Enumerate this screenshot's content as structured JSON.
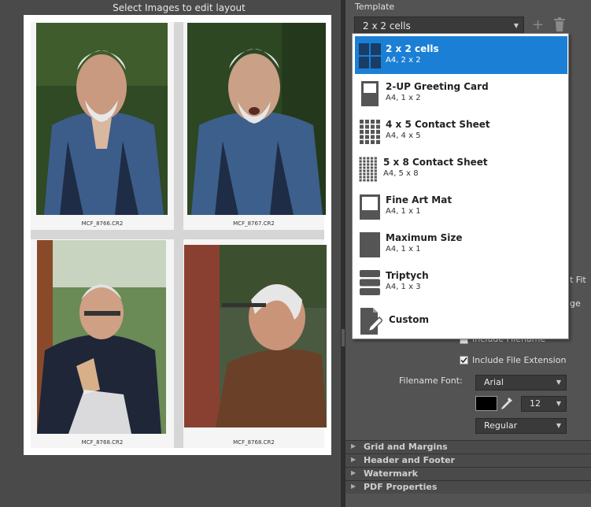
{
  "left_panel": {
    "title": "Select Images to edit layout",
    "photos": [
      {
        "filename": "MCF_8766.CR2"
      },
      {
        "filename": "MCF_8767.CR2"
      },
      {
        "filename": "MCF_8768.CR2"
      },
      {
        "filename": "MCF_8768.CR2"
      }
    ]
  },
  "right_panel": {
    "template_label": "Template",
    "template_value": "2 x 2 cells",
    "add_icon": "plus-icon",
    "delete_icon": "trash-icon",
    "dropdown": [
      {
        "name": "2 x 2 cells",
        "sub": "A4, 2 x 2",
        "icon": "grid-2x2-icon",
        "selected": true
      },
      {
        "name": "2-UP Greeting Card",
        "sub": "A4, 1 x 2",
        "icon": "greeting-card-icon",
        "selected": false
      },
      {
        "name": "4 x 5 Contact Sheet",
        "sub": "A4, 4 x 5",
        "icon": "contact-sheet-4x5-icon",
        "selected": false
      },
      {
        "name": "5 x 8 Contact Sheet",
        "sub": "A4, 5 x 8",
        "icon": "contact-sheet-5x8-icon",
        "selected": false
      },
      {
        "name": "Fine Art Mat",
        "sub": "A4, 1 x 1",
        "icon": "fine-art-mat-icon",
        "selected": false
      },
      {
        "name": "Maximum Size",
        "sub": "A4, 1 x 1",
        "icon": "maximum-size-icon",
        "selected": false
      },
      {
        "name": "Triptych",
        "sub": "A4, 1 x 3",
        "icon": "triptych-icon",
        "selected": false
      },
      {
        "name": "Custom",
        "sub": "",
        "icon": "custom-edit-icon",
        "selected": false
      }
    ],
    "partial_fit": "t Fit",
    "partial_ge": "ge",
    "include_filename": "Include Filename",
    "include_extension": "Include File Extension",
    "filename_font_label": "Filename Font:",
    "font_value": "Arial",
    "font_size": "12",
    "font_style": "Regular",
    "font_color": "#000000"
  },
  "sections": [
    "Grid and Margins",
    "Header and Footer",
    "Watermark",
    "PDF Properties"
  ]
}
